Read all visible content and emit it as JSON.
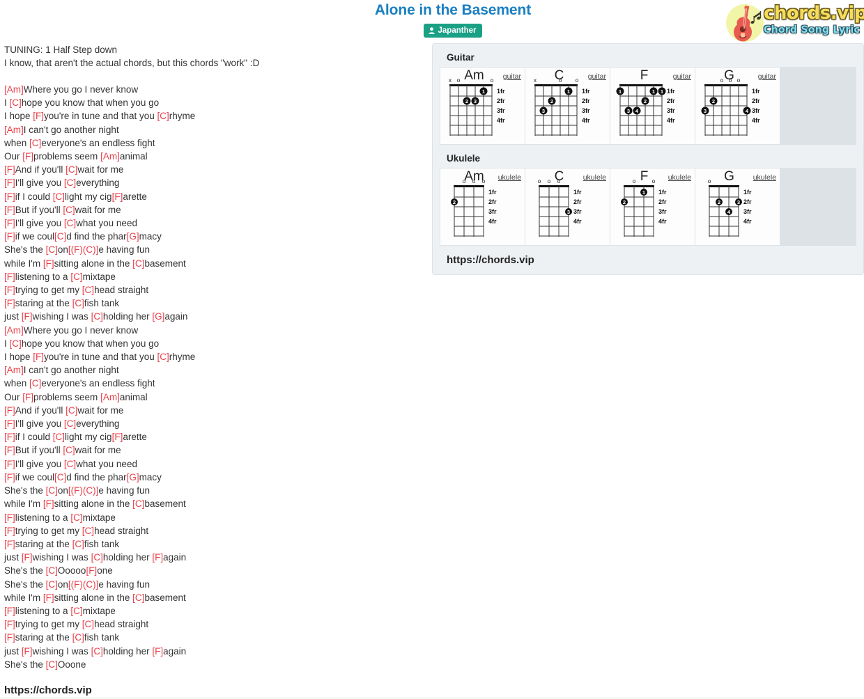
{
  "header": {
    "song_title": "Alone in the Basement",
    "artist_badge": {
      "label": "Japanther",
      "icon": "user-icon",
      "bg_color": "#1aa085"
    },
    "title_color": "#1a7fc1"
  },
  "logo": {
    "main_text": "chords.vip",
    "sub_text": "Chord Song Lyric",
    "icon": "guitar-icon",
    "main_color": "#f5dd5a",
    "sub_color": "#7fdff0",
    "circle_color": "#f2f5a8"
  },
  "lyrics": {
    "intro": "TUNING: 1 Half Step down\nI know, that aren't the actual chords, but this chords \"work\" :D",
    "chord_color": "#e8404a",
    "lines": [
      [
        {
          "t": "[Am]",
          "c": true
        },
        {
          "t": "Where you go I never know",
          "c": false
        }
      ],
      [
        {
          "t": "I ",
          "c": false
        },
        {
          "t": "[C]",
          "c": true
        },
        {
          "t": "hope you know that when you go",
          "c": false
        }
      ],
      [
        {
          "t": "I hope ",
          "c": false
        },
        {
          "t": "[F]",
          "c": true
        },
        {
          "t": "you're in tune and that you ",
          "c": false
        },
        {
          "t": "[C]",
          "c": true
        },
        {
          "t": "rhyme",
          "c": false
        }
      ],
      [
        {
          "t": "[Am]",
          "c": true
        },
        {
          "t": "I can't go another night",
          "c": false
        }
      ],
      [
        {
          "t": "when ",
          "c": false
        },
        {
          "t": "[C]",
          "c": true
        },
        {
          "t": "everyone's an endless fight",
          "c": false
        }
      ],
      [
        {
          "t": "Our ",
          "c": false
        },
        {
          "t": "[F]",
          "c": true
        },
        {
          "t": "problems seem ",
          "c": false
        },
        {
          "t": "[Am]",
          "c": true
        },
        {
          "t": "animal",
          "c": false
        }
      ],
      [
        {
          "t": "[F]",
          "c": true
        },
        {
          "t": "And if you'll ",
          "c": false
        },
        {
          "t": "[C]",
          "c": true
        },
        {
          "t": "wait for me",
          "c": false
        }
      ],
      [
        {
          "t": "[F]",
          "c": true
        },
        {
          "t": "I'll give you ",
          "c": false
        },
        {
          "t": "[C]",
          "c": true
        },
        {
          "t": "everything",
          "c": false
        }
      ],
      [
        {
          "t": "[F]",
          "c": true
        },
        {
          "t": "if I could ",
          "c": false
        },
        {
          "t": "[C]",
          "c": true
        },
        {
          "t": "light my cig",
          "c": false
        },
        {
          "t": "[F]",
          "c": true
        },
        {
          "t": "arette",
          "c": false
        }
      ],
      [
        {
          "t": "[F]",
          "c": true
        },
        {
          "t": "But if you'll ",
          "c": false
        },
        {
          "t": "[C]",
          "c": true
        },
        {
          "t": "wait for me",
          "c": false
        }
      ],
      [
        {
          "t": "[F]",
          "c": true
        },
        {
          "t": "I'll give you ",
          "c": false
        },
        {
          "t": "[C]",
          "c": true
        },
        {
          "t": "what you need",
          "c": false
        }
      ],
      [
        {
          "t": "[F]",
          "c": true
        },
        {
          "t": "if we coul",
          "c": false
        },
        {
          "t": "[C]",
          "c": true
        },
        {
          "t": "d find the phar",
          "c": false
        },
        {
          "t": "[G]",
          "c": true
        },
        {
          "t": "macy",
          "c": false
        }
      ],
      [
        {
          "t": "She's the ",
          "c": false
        },
        {
          "t": "[C]",
          "c": true
        },
        {
          "t": "on",
          "c": false
        },
        {
          "t": "[(F)(C)]",
          "c": true
        },
        {
          "t": "e having fun",
          "c": false
        }
      ],
      [
        {
          "t": "while I'm ",
          "c": false
        },
        {
          "t": "[F]",
          "c": true
        },
        {
          "t": "sitting alone in the ",
          "c": false
        },
        {
          "t": "[C]",
          "c": true
        },
        {
          "t": "basement",
          "c": false
        }
      ],
      [
        {
          "t": "[F]",
          "c": true
        },
        {
          "t": "listening to a ",
          "c": false
        },
        {
          "t": "[C]",
          "c": true
        },
        {
          "t": "mixtape",
          "c": false
        }
      ],
      [
        {
          "t": "[F]",
          "c": true
        },
        {
          "t": "trying to get my ",
          "c": false
        },
        {
          "t": "[C]",
          "c": true
        },
        {
          "t": "head straight",
          "c": false
        }
      ],
      [
        {
          "t": "[F]",
          "c": true
        },
        {
          "t": "staring at the ",
          "c": false
        },
        {
          "t": "[C]",
          "c": true
        },
        {
          "t": "fish tank",
          "c": false
        }
      ],
      [
        {
          "t": "just ",
          "c": false
        },
        {
          "t": "[F]",
          "c": true
        },
        {
          "t": "wishing I was ",
          "c": false
        },
        {
          "t": "[C]",
          "c": true
        },
        {
          "t": "holding her ",
          "c": false
        },
        {
          "t": "[G]",
          "c": true
        },
        {
          "t": "again",
          "c": false
        }
      ],
      [
        {
          "t": "[Am]",
          "c": true
        },
        {
          "t": "Where you go I never know",
          "c": false
        }
      ],
      [
        {
          "t": "I ",
          "c": false
        },
        {
          "t": "[C]",
          "c": true
        },
        {
          "t": "hope you know that when you go",
          "c": false
        }
      ],
      [
        {
          "t": "I hope ",
          "c": false
        },
        {
          "t": "[F]",
          "c": true
        },
        {
          "t": "you're in tune and that you ",
          "c": false
        },
        {
          "t": "[C]",
          "c": true
        },
        {
          "t": "rhyme",
          "c": false
        }
      ],
      [
        {
          "t": "[Am]",
          "c": true
        },
        {
          "t": "I can't go another night",
          "c": false
        }
      ],
      [
        {
          "t": "when ",
          "c": false
        },
        {
          "t": "[C]",
          "c": true
        },
        {
          "t": "everyone's an endless fight",
          "c": false
        }
      ],
      [
        {
          "t": "Our ",
          "c": false
        },
        {
          "t": "[F]",
          "c": true
        },
        {
          "t": "problems seem ",
          "c": false
        },
        {
          "t": "[Am]",
          "c": true
        },
        {
          "t": "animal",
          "c": false
        }
      ],
      [
        {
          "t": "[F]",
          "c": true
        },
        {
          "t": "And if you'll ",
          "c": false
        },
        {
          "t": "[C]",
          "c": true
        },
        {
          "t": "wait for me",
          "c": false
        }
      ],
      [
        {
          "t": "[F]",
          "c": true
        },
        {
          "t": "I'll give you ",
          "c": false
        },
        {
          "t": "[C]",
          "c": true
        },
        {
          "t": "everything",
          "c": false
        }
      ],
      [
        {
          "t": "[F]",
          "c": true
        },
        {
          "t": "if I could ",
          "c": false
        },
        {
          "t": "[C]",
          "c": true
        },
        {
          "t": "light my cig",
          "c": false
        },
        {
          "t": "[F]",
          "c": true
        },
        {
          "t": "arette",
          "c": false
        }
      ],
      [
        {
          "t": "[F]",
          "c": true
        },
        {
          "t": "But if you'll ",
          "c": false
        },
        {
          "t": "[C]",
          "c": true
        },
        {
          "t": "wait for me",
          "c": false
        }
      ],
      [
        {
          "t": "[F]",
          "c": true
        },
        {
          "t": "I'll give you ",
          "c": false
        },
        {
          "t": "[C]",
          "c": true
        },
        {
          "t": "what you need",
          "c": false
        }
      ],
      [
        {
          "t": "[F]",
          "c": true
        },
        {
          "t": "if we coul",
          "c": false
        },
        {
          "t": "[C]",
          "c": true
        },
        {
          "t": "d find the phar",
          "c": false
        },
        {
          "t": "[G]",
          "c": true
        },
        {
          "t": "macy",
          "c": false
        }
      ],
      [
        {
          "t": "She's the ",
          "c": false
        },
        {
          "t": "[C]",
          "c": true
        },
        {
          "t": "on",
          "c": false
        },
        {
          "t": "[(F)(C)]",
          "c": true
        },
        {
          "t": "e having fun",
          "c": false
        }
      ],
      [
        {
          "t": "while I'm ",
          "c": false
        },
        {
          "t": "[F]",
          "c": true
        },
        {
          "t": "sitting alone in the ",
          "c": false
        },
        {
          "t": "[C]",
          "c": true
        },
        {
          "t": "basement",
          "c": false
        }
      ],
      [
        {
          "t": "[F]",
          "c": true
        },
        {
          "t": "listening to a ",
          "c": false
        },
        {
          "t": "[C]",
          "c": true
        },
        {
          "t": "mixtape",
          "c": false
        }
      ],
      [
        {
          "t": "[F]",
          "c": true
        },
        {
          "t": "trying to get my ",
          "c": false
        },
        {
          "t": "[C]",
          "c": true
        },
        {
          "t": "head straight",
          "c": false
        }
      ],
      [
        {
          "t": "[F]",
          "c": true
        },
        {
          "t": "staring at the ",
          "c": false
        },
        {
          "t": "[C]",
          "c": true
        },
        {
          "t": "fish tank",
          "c": false
        }
      ],
      [
        {
          "t": "just ",
          "c": false
        },
        {
          "t": "[F]",
          "c": true
        },
        {
          "t": "wishing I was ",
          "c": false
        },
        {
          "t": "[C]",
          "c": true
        },
        {
          "t": "holding her ",
          "c": false
        },
        {
          "t": "[F]",
          "c": true
        },
        {
          "t": "again",
          "c": false
        }
      ],
      [
        {
          "t": "She's the ",
          "c": false
        },
        {
          "t": "[C]",
          "c": true
        },
        {
          "t": "Ooooo",
          "c": false
        },
        {
          "t": "[F]",
          "c": true
        },
        {
          "t": "one",
          "c": false
        }
      ],
      [
        {
          "t": "She's the ",
          "c": false
        },
        {
          "t": "[C]",
          "c": true
        },
        {
          "t": "on",
          "c": false
        },
        {
          "t": "[(F)(C)]",
          "c": true
        },
        {
          "t": "e having fun",
          "c": false
        }
      ],
      [
        {
          "t": "while I'm ",
          "c": false
        },
        {
          "t": "[F]",
          "c": true
        },
        {
          "t": "sitting alone in the ",
          "c": false
        },
        {
          "t": "[C]",
          "c": true
        },
        {
          "t": "basement",
          "c": false
        }
      ],
      [
        {
          "t": "[F]",
          "c": true
        },
        {
          "t": "listening to a ",
          "c": false
        },
        {
          "t": "[C]",
          "c": true
        },
        {
          "t": "mixtape",
          "c": false
        }
      ],
      [
        {
          "t": "[F]",
          "c": true
        },
        {
          "t": "trying to get my ",
          "c": false
        },
        {
          "t": "[C]",
          "c": true
        },
        {
          "t": "head straight",
          "c": false
        }
      ],
      [
        {
          "t": "[F]",
          "c": true
        },
        {
          "t": "staring at the ",
          "c": false
        },
        {
          "t": "[C]",
          "c": true
        },
        {
          "t": "fish tank",
          "c": false
        }
      ],
      [
        {
          "t": "just ",
          "c": false
        },
        {
          "t": "[F]",
          "c": true
        },
        {
          "t": "wishing I was ",
          "c": false
        },
        {
          "t": "[C]",
          "c": true
        },
        {
          "t": "holding her ",
          "c": false
        },
        {
          "t": "[F]",
          "c": true
        },
        {
          "t": "again",
          "c": false
        }
      ],
      [
        {
          "t": "She's the ",
          "c": false
        },
        {
          "t": "[C]",
          "c": true
        },
        {
          "t": "Ooone",
          "c": false
        }
      ]
    ],
    "bottom_url": "https://chords.vip"
  },
  "chord_panel": {
    "guitar_label": "Guitar",
    "ukulele_label": "Ukulele",
    "panel_url": "https://chords.vip",
    "fret_labels": [
      "1fr",
      "2fr",
      "3fr",
      "4fr"
    ],
    "guitar_chords": [
      {
        "name": "Am",
        "instrument": "guitar",
        "strings": 6,
        "open_markers": [
          {
            "string": 2,
            "mark": "o"
          },
          {
            "string": 6,
            "mark": "o"
          }
        ],
        "muted_markers": [
          {
            "string": 1,
            "mark": "x"
          }
        ],
        "dots": [
          {
            "string": 5,
            "fret": 1,
            "finger": "1"
          },
          {
            "string": 3,
            "fret": 2,
            "finger": "2"
          },
          {
            "string": 4,
            "fret": 2,
            "finger": "3"
          }
        ]
      },
      {
        "name": "C",
        "instrument": "guitar",
        "strings": 6,
        "open_markers": [
          {
            "string": 4,
            "mark": "o"
          },
          {
            "string": 6,
            "mark": "o"
          }
        ],
        "muted_markers": [
          {
            "string": 1,
            "mark": "x"
          }
        ],
        "dots": [
          {
            "string": 5,
            "fret": 1,
            "finger": "1"
          },
          {
            "string": 3,
            "fret": 2,
            "finger": "2"
          },
          {
            "string": 2,
            "fret": 3,
            "finger": "3"
          }
        ]
      },
      {
        "name": "F",
        "instrument": "guitar",
        "strings": 6,
        "open_markers": [],
        "muted_markers": [],
        "dots": [
          {
            "string": 1,
            "fret": 1,
            "finger": "1"
          },
          {
            "string": 5,
            "fret": 1,
            "finger": "1"
          },
          {
            "string": 6,
            "fret": 1,
            "finger": "1"
          },
          {
            "string": 4,
            "fret": 2,
            "finger": "2"
          },
          {
            "string": 2,
            "fret": 3,
            "finger": "3"
          },
          {
            "string": 3,
            "fret": 3,
            "finger": "4"
          }
        ]
      },
      {
        "name": "G",
        "instrument": "guitar",
        "strings": 6,
        "open_markers": [
          {
            "string": 3,
            "mark": "o"
          },
          {
            "string": 4,
            "mark": "o"
          },
          {
            "string": 5,
            "mark": "o"
          }
        ],
        "muted_markers": [],
        "dots": [
          {
            "string": 2,
            "fret": 2,
            "finger": "2"
          },
          {
            "string": 1,
            "fret": 3,
            "finger": "3"
          },
          {
            "string": 6,
            "fret": 3,
            "finger": "4"
          }
        ]
      }
    ],
    "ukulele_chords": [
      {
        "name": "Am",
        "instrument": "ukulele",
        "strings": 4,
        "open_markers": [
          {
            "string": 2,
            "mark": "o"
          },
          {
            "string": 3,
            "mark": "o"
          },
          {
            "string": 4,
            "mark": "o"
          }
        ],
        "muted_markers": [],
        "dots": [
          {
            "string": 1,
            "fret": 2,
            "finger": "2"
          }
        ]
      },
      {
        "name": "C",
        "instrument": "ukulele",
        "strings": 4,
        "open_markers": [
          {
            "string": 1,
            "mark": "o"
          },
          {
            "string": 2,
            "mark": "o"
          },
          {
            "string": 3,
            "mark": "o"
          }
        ],
        "muted_markers": [],
        "dots": [
          {
            "string": 4,
            "fret": 3,
            "finger": "3"
          }
        ]
      },
      {
        "name": "F",
        "instrument": "ukulele",
        "strings": 4,
        "open_markers": [
          {
            "string": 2,
            "mark": "o"
          },
          {
            "string": 4,
            "mark": "o"
          }
        ],
        "muted_markers": [],
        "dots": [
          {
            "string": 3,
            "fret": 1,
            "finger": "1"
          },
          {
            "string": 1,
            "fret": 2,
            "finger": "2"
          }
        ]
      },
      {
        "name": "G",
        "instrument": "ukulele",
        "strings": 4,
        "open_markers": [
          {
            "string": 1,
            "mark": "o"
          }
        ],
        "muted_markers": [],
        "dots": [
          {
            "string": 2,
            "fret": 2,
            "finger": "2"
          },
          {
            "string": 4,
            "fret": 2,
            "finger": "3"
          },
          {
            "string": 3,
            "fret": 3,
            "finger": "4"
          }
        ]
      }
    ]
  }
}
